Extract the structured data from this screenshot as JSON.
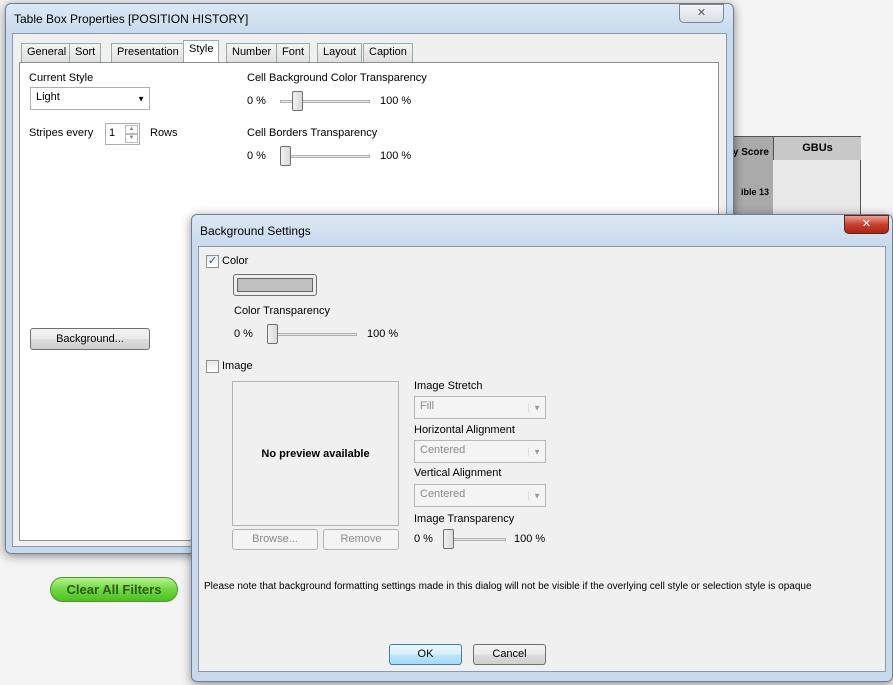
{
  "background_app": {
    "table_headers": [
      "y Score",
      "GBUs"
    ],
    "table_cell": "ible 13",
    "clear_filters_label": "Clear All Filters"
  },
  "table_box_dialog": {
    "title": "Table Box Properties [POSITION HISTORY]",
    "close_icon": "close-icon",
    "tabs": [
      {
        "label": "General"
      },
      {
        "label": "Sort"
      },
      {
        "label": "Presentation"
      },
      {
        "label": "Style",
        "active": true
      },
      {
        "label": "Number"
      },
      {
        "label": "Font"
      },
      {
        "label": "Layout"
      },
      {
        "label": "Caption"
      }
    ],
    "current_style_label": "Current Style",
    "current_style_value": "Light",
    "stripes_label": "Stripes every",
    "stripes_value": "1",
    "rows_label": "Rows",
    "cell_bg_transparency_label": "Cell Background Color Transparency",
    "cell_bg_transparency_percent": 15,
    "cell_borders_transparency_label": "Cell Borders Transparency",
    "cell_borders_transparency_percent": 0,
    "min_label": "0 %",
    "max_label": "100 %",
    "background_button": "Background..."
  },
  "background_dialog": {
    "title": "Background Settings",
    "color_label": "Color",
    "color_checked": true,
    "color_swatch": "#c0c0c0",
    "color_transparency_label": "Color Transparency",
    "color_transparency_percent": 0,
    "image_label": "Image",
    "image_checked": false,
    "no_preview": "No preview available",
    "browse_button": "Browse...",
    "remove_button": "Remove",
    "image_stretch_label": "Image Stretch",
    "image_stretch_value": "Fill",
    "horizontal_alignment_label": "Horizontal Alignment",
    "horizontal_alignment_value": "Centered",
    "vertical_alignment_label": "Vertical Alignment",
    "vertical_alignment_value": "Centered",
    "image_transparency_label": "Image Transparency",
    "image_transparency_percent": 0,
    "min_label": "0 %",
    "max_label": "100 %",
    "note": "Please note that background formatting settings made in this dialog will not be visible if the overlying cell style or selection style is opaque",
    "ok_button": "OK",
    "cancel_button": "Cancel"
  }
}
